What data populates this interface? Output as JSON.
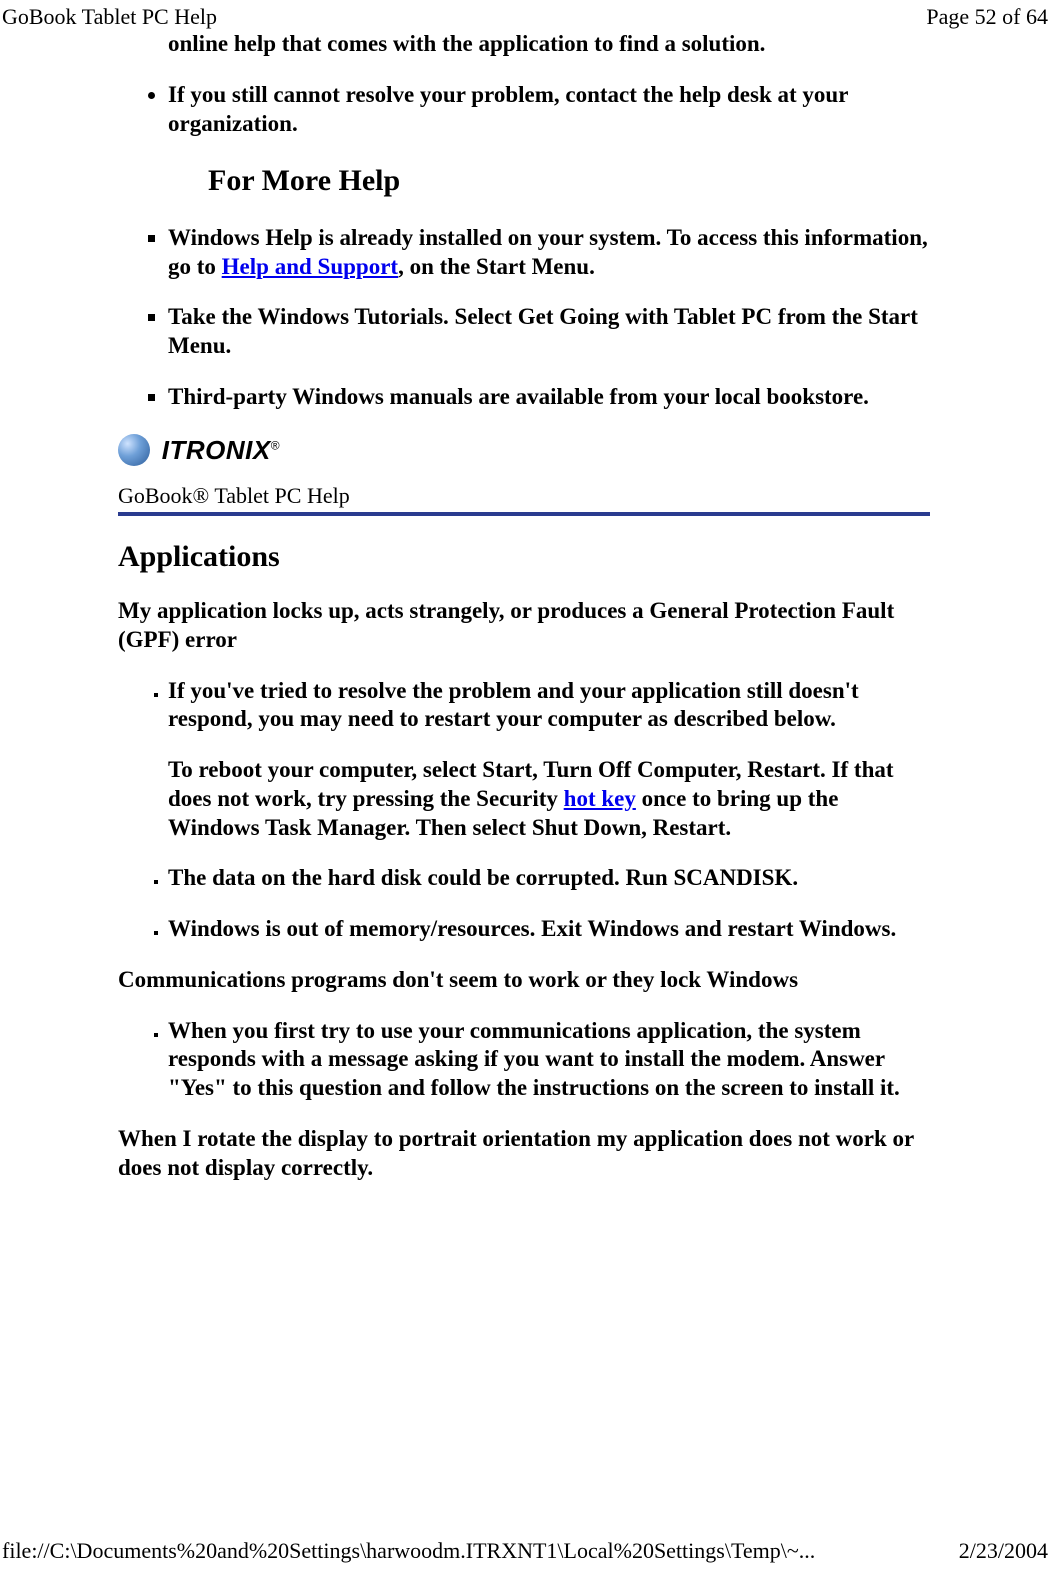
{
  "header": {
    "title": "GoBook Tablet PC Help",
    "page_number": "Page 52 of 64"
  },
  "footer": {
    "path": "file://C:\\Documents%20and%20Settings\\harwoodm.ITRXNT1\\Local%20Settings\\Temp\\~...",
    "date": "2/23/2004"
  },
  "intro_fragment": "online help that comes with the application to find a solution.",
  "top_bullets": [
    "If you still cannot resolve your problem, contact the help desk at your organization."
  ],
  "more_help_heading": "For More Help",
  "more_help_items": [
    {
      "prefix": "Windows Help is already installed on your system.  To access this information, go to ",
      "link": "Help and Support",
      "suffix": ", on the Start Menu."
    },
    {
      "prefix": "Take the Windows Tutorials.  Select Get Going with Tablet PC from the Start Menu.",
      "link": "",
      "suffix": ""
    },
    {
      "prefix": "Third-party Windows manuals are available from your local bookstore.",
      "link": "",
      "suffix": ""
    }
  ],
  "brand": {
    "name": "ITRONIX",
    "subtitle": "GoBook® Tablet PC Help"
  },
  "applications": {
    "heading": "Applications",
    "q1": "My application locks up, acts strangely, or produces a General Protection Fault (GPF) error",
    "q1_items": [
      {
        "prefix": "If you've tried to resolve the problem and your application still doesn't respond, you may need to restart your computer as described below.",
        "sub_prefix": "To reboot your computer, select Start, Turn Off Computer, Restart.  If that does not work, try pressing the Security ",
        "link": "hot key",
        "sub_suffix": " once to bring up the Windows Task Manager. Then select Shut Down, Restart."
      },
      {
        "prefix": "The data on the hard disk could be corrupted.  Run SCANDISK.",
        "sub_prefix": "",
        "link": "",
        "sub_suffix": ""
      },
      {
        "prefix": "Windows is out of memory/resources. Exit Windows and restart Windows.",
        "sub_prefix": "",
        "link": "",
        "sub_suffix": ""
      }
    ],
    "q2": "Communications programs don't seem to work or they lock Windows",
    "q2_items": [
      "When you first try to use your communications application, the system responds with a message asking if you want to install the modem. Answer \"Yes\" to this question and follow the instructions on the screen to install it."
    ],
    "q3": "When I rotate the display to portrait orientation my application does not work or does not display correctly."
  }
}
